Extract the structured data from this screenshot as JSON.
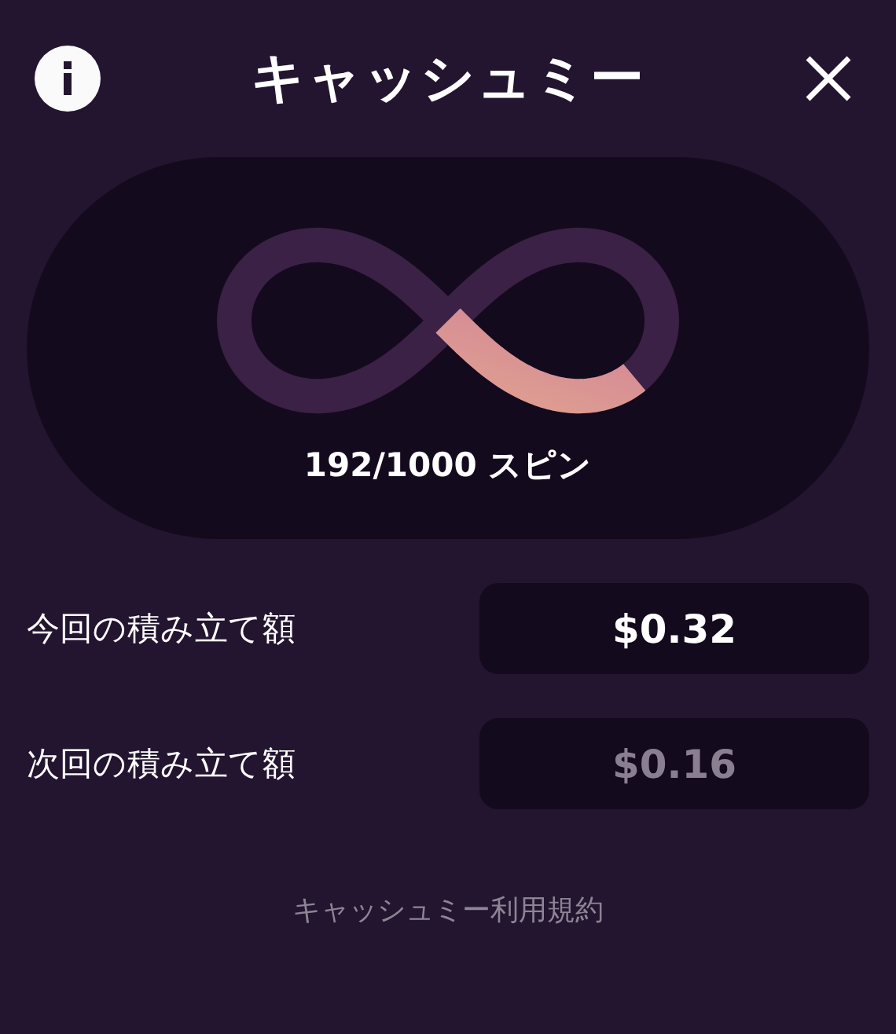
{
  "header": {
    "title": "キャッシュミー"
  },
  "progress": {
    "label": "192/1000 スピン"
  },
  "rows": [
    {
      "label": "今回の積み立て額",
      "value": "$0.32",
      "dimmed": false
    },
    {
      "label": "次回の積み立て額",
      "value": "$0.16",
      "dimmed": true
    }
  ],
  "footer": {
    "link": "キャッシュミー利用規約"
  }
}
